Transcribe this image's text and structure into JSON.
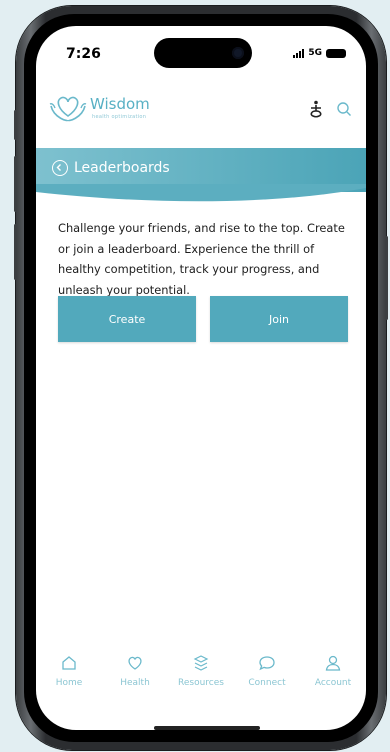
{
  "status": {
    "time": "7:26",
    "network": "5G"
  },
  "header": {
    "brand": "Wisdom",
    "tagline": "health optimization",
    "icons": [
      "wellness-figure-icon",
      "search-icon"
    ]
  },
  "banner": {
    "title": "Leaderboards",
    "back_icon": "chevron-left-circle-icon"
  },
  "main": {
    "description": "Challenge your friends, and rise to the top. Create or join a leaderboard. Experience the thrill of healthy competition, track your progress, and unleash your potential.",
    "create_label": "Create",
    "join_label": "Join"
  },
  "tabs": [
    {
      "label": "Home",
      "icon": "home-icon"
    },
    {
      "label": "Health",
      "icon": "heart-icon"
    },
    {
      "label": "Resources",
      "icon": "layers-icon"
    },
    {
      "label": "Connect",
      "icon": "chat-bubble-icon"
    },
    {
      "label": "Account",
      "icon": "user-icon"
    }
  ],
  "colors": {
    "accent": "#52a9bc",
    "banner_start": "#7ec1cf",
    "banner_end": "#4ba4b7",
    "tab_label": "#8cc6d3",
    "background": "#e2eef2"
  }
}
